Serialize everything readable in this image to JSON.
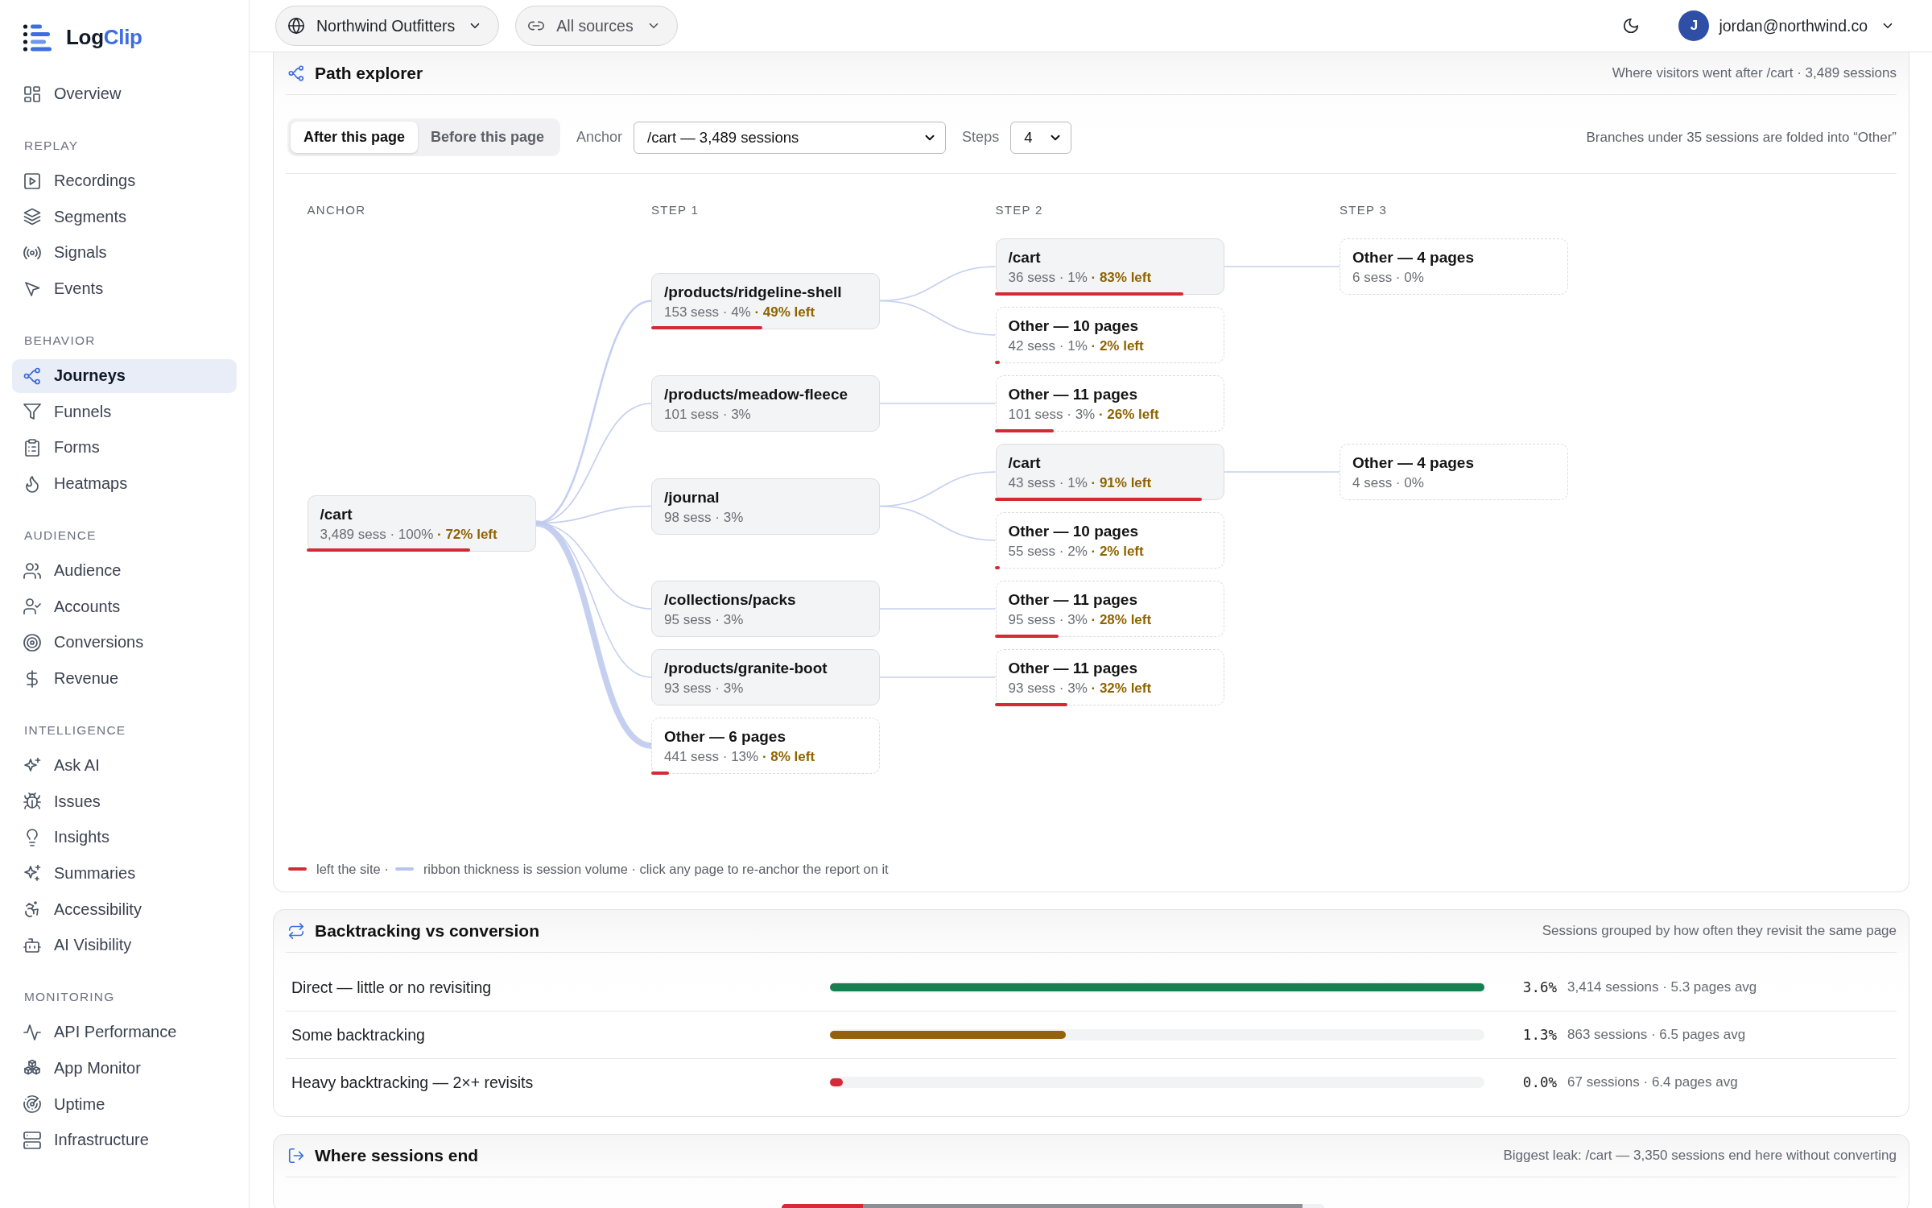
{
  "sidebar": {
    "logo": {
      "text": "Log",
      "accent": "Clip"
    },
    "sections": [
      {
        "items": [
          {
            "label": "Overview",
            "selected": false
          }
        ]
      },
      {
        "heading": "REPLAY",
        "items": [
          {
            "label": "Recordings",
            "selected": false
          },
          {
            "label": "Segments",
            "selected": false
          },
          {
            "label": "Signals",
            "selected": false
          },
          {
            "label": "Events",
            "selected": false
          }
        ]
      },
      {
        "heading": "BEHAVIOR",
        "items": [
          {
            "label": "Journeys",
            "selected": true
          },
          {
            "label": "Funnels",
            "selected": false
          },
          {
            "label": "Forms",
            "selected": false
          },
          {
            "label": "Heatmaps",
            "selected": false
          }
        ]
      },
      {
        "heading": "AUDIENCE",
        "items": [
          {
            "label": "Audience",
            "selected": false
          },
          {
            "label": "Accounts",
            "selected": false
          },
          {
            "label": "Conversions",
            "selected": false
          },
          {
            "label": "Revenue",
            "selected": false
          }
        ]
      },
      {
        "heading": "INTELLIGENCE",
        "items": [
          {
            "label": "Ask AI",
            "selected": false
          },
          {
            "label": "Issues",
            "selected": false
          },
          {
            "label": "Insights",
            "selected": false
          },
          {
            "label": "Summaries",
            "selected": false
          },
          {
            "label": "Accessibility",
            "selected": false
          },
          {
            "label": "AI Visibility",
            "selected": false
          }
        ]
      },
      {
        "heading": "MONITORING",
        "items": [
          {
            "label": "API Performance",
            "selected": false
          },
          {
            "label": "App Monitor",
            "selected": false
          },
          {
            "label": "Uptime",
            "selected": false
          },
          {
            "label": "Infrastructure",
            "selected": false
          }
        ]
      }
    ]
  },
  "topbar": {
    "workspace": "Northwind Outfitters",
    "source_filter": "All sources",
    "user": {
      "initial": "J",
      "email": "jordan@northwind.co"
    }
  },
  "path_explorer": {
    "title": "Path explorer",
    "summary": "Where visitors went after /cart · 3,489 sessions",
    "direction_tabs": [
      {
        "label": "After this page",
        "selected": true
      },
      {
        "label": "Before this page",
        "selected": false
      }
    ],
    "anchor_label": "Anchor",
    "anchor_value": "/cart — 3,489 sessions",
    "steps_label": "Steps",
    "steps_value": "4",
    "note": "Branches under 35 sessions are folded into “Other”",
    "flow": {
      "columns": [
        "ANCHOR",
        "STEP 1",
        "STEP 2",
        "STEP 3"
      ],
      "root": {
        "title": "/cart",
        "meta": "3,489 sess · 100% **· 72% left**",
        "kind": "page",
        "level": 0.72,
        "children": [
          {
            "title": "/products/ridgeline-shell",
            "meta": "153 sess · 4% **· 49% left**",
            "kind": "page",
            "level": 0.49,
            "children": [
              {
                "title": "/cart",
                "meta": "36 sess · 1% **· 83% left**",
                "kind": "page",
                "level": 0.83,
                "children": [
                  {
                    "title": "Other — 4 pages",
                    "meta": "6 sess · 0%",
                    "kind": "group"
                  }
                ]
              },
              {
                "title": "Other — 10 pages",
                "meta": "42 sess · 1% **· 2% left**",
                "kind": "group",
                "level": 0.02
              }
            ]
          },
          {
            "title": "/products/meadow-fleece",
            "meta": "101 sess · 3%",
            "kind": "page",
            "children": [
              {
                "title": "Other — 11 pages",
                "meta": "101 sess · 3% **· 26% left**",
                "kind": "group",
                "level": 0.26
              }
            ]
          },
          {
            "title": "/journal",
            "meta": "98 sess · 3%",
            "kind": "page",
            "children": [
              {
                "title": "/cart",
                "meta": "43 sess · 1% **· 91% left**",
                "kind": "page",
                "level": 0.91,
                "children": [
                  {
                    "title": "Other — 4 pages",
                    "meta": "4 sess · 0%",
                    "kind": "group"
                  }
                ]
              },
              {
                "title": "Other — 10 pages",
                "meta": "55 sess · 2% **· 2% left**",
                "kind": "group",
                "level": 0.02
              }
            ]
          },
          {
            "title": "/collections/packs",
            "meta": "95 sess · 3%",
            "kind": "page",
            "children": [
              {
                "title": "Other — 11 pages",
                "meta": "95 sess · 3% **· 28% left**",
                "kind": "group",
                "level": 0.28
              }
            ]
          },
          {
            "title": "/products/granite-boot",
            "meta": "93 sess · 3%",
            "kind": "page",
            "children": [
              {
                "title": "Other — 11 pages",
                "meta": "93 sess · 3% **· 32% left**",
                "kind": "group",
                "level": 0.32
              }
            ]
          },
          {
            "title": "Other — 6 pages",
            "meta": "441 sess · 13% **· 8% left**",
            "kind": "group",
            "level": 0.08
          }
        ]
      }
    },
    "legend": [
      {
        "kind": "exit",
        "label": "left the site ·"
      },
      {
        "kind": "ribbon",
        "label": "ribbon thickness is session volume · click any page to re-anchor the report on it"
      }
    ]
  },
  "backtracking": {
    "title": "Backtracking vs conversion",
    "summary": "Sessions grouped by how often they revisit the same page",
    "rows": [
      {
        "label": "Direct — little or no revisiting",
        "level": 1.0,
        "color": "#158050",
        "rate": "3.6%",
        "detail": "3,414 sessions · 5.3 pages avg"
      },
      {
        "label": "Some backtracking",
        "level": 0.36,
        "color": "#94620a",
        "rate": "1.3%",
        "detail": "863 sessions · 6.5 pages avg"
      },
      {
        "label": "Heavy backtracking — 2×+ revisits",
        "level": 0.02,
        "color": "#d42a3a",
        "rate": "0.0%",
        "detail": "67 sessions · 6.4 pages avg"
      }
    ]
  },
  "session_ends": {
    "title": "Where sessions end",
    "summary": "Biggest leak: /cart — 3,350 sessions end here without converting",
    "rows": [
      {
        "bar": [
          {
            "level": 0.15,
            "color": "#d42a3a"
          },
          {
            "level": 0.96,
            "color": "#8e8e96"
          }
        ]
      }
    ]
  }
}
